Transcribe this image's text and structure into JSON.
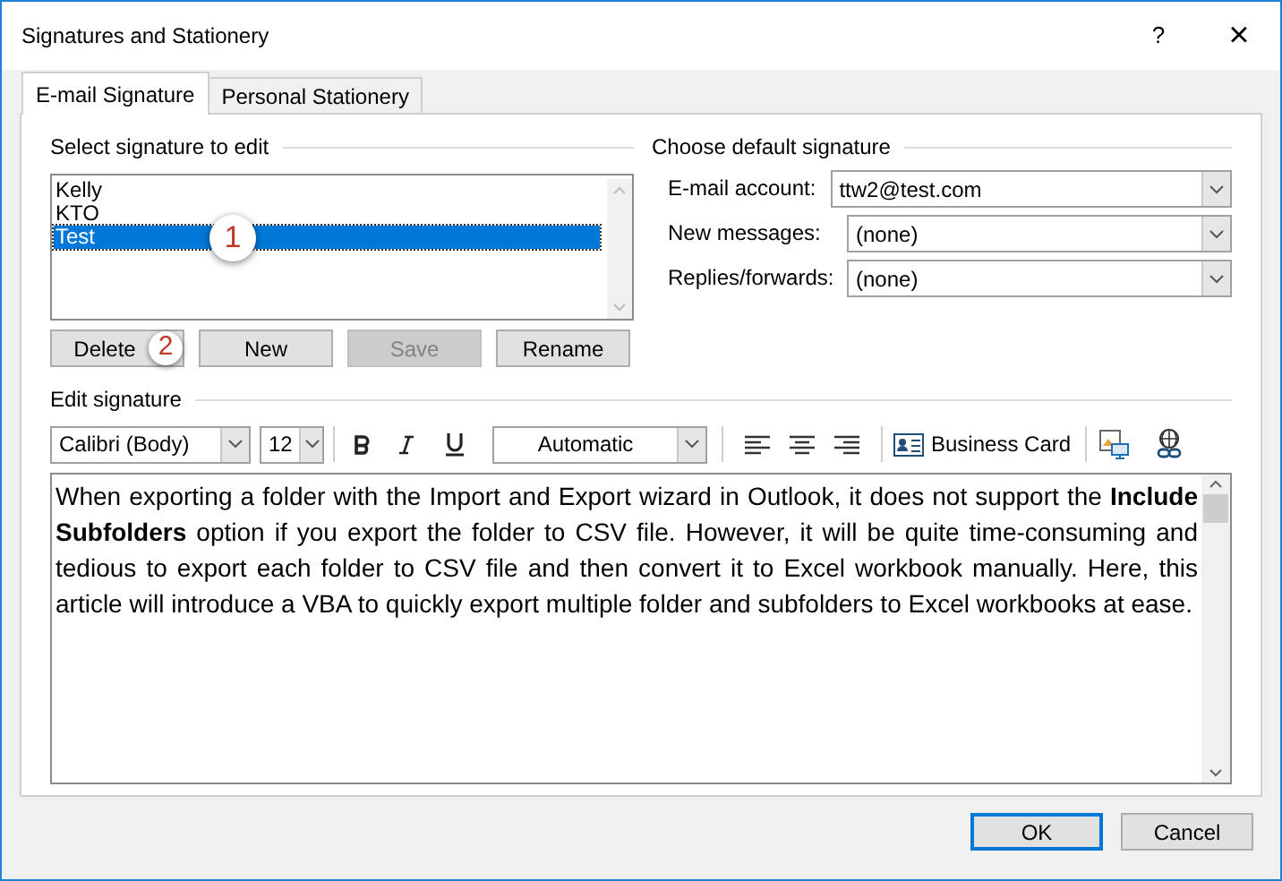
{
  "window": {
    "title": "Signatures and Stationery",
    "help": "?",
    "close": "×"
  },
  "tabs": [
    {
      "label": "E-mail Signature",
      "selected": true
    },
    {
      "label": "Personal Stationery",
      "selected": false
    }
  ],
  "select_signature": {
    "label": "Select signature to edit",
    "items": [
      {
        "label": "Kelly",
        "selected": false
      },
      {
        "label": "KTO",
        "selected": false
      },
      {
        "label": "Test",
        "selected": true
      }
    ],
    "callout": "1",
    "buttons": [
      {
        "label": "Delete",
        "disabled": false,
        "callout": "2"
      },
      {
        "label": "New",
        "disabled": false
      },
      {
        "label": "Save",
        "disabled": true
      },
      {
        "label": "Rename",
        "disabled": false
      }
    ]
  },
  "default_signature": {
    "label": "Choose default signature",
    "fields": [
      {
        "label": "E-mail account:",
        "value": "ttw2@test.com"
      },
      {
        "label": "New messages:",
        "value": "(none)"
      },
      {
        "label": "Replies/forwards:",
        "value": "(none)"
      }
    ]
  },
  "edit_signature": {
    "label": "Edit signature",
    "font": "Calibri (Body)",
    "size": "12",
    "color_menu": "Automatic",
    "business_card": "Business Card",
    "body": "When exporting a folder with the Import and Export wizard in Outlook, it does not support the **Include Subfolders** option if you export the folder to CSV file. However, it will be quite time-consuming and tedious to export each folder to CSV file and then convert it to Excel workbook manually. Here, this article will introduce a VBA to quickly export multiple folder and subfolders to Excel workbooks at ease."
  },
  "footer_buttons": [
    {
      "label": "OK",
      "default": true
    },
    {
      "label": "Cancel",
      "default": false
    }
  ]
}
